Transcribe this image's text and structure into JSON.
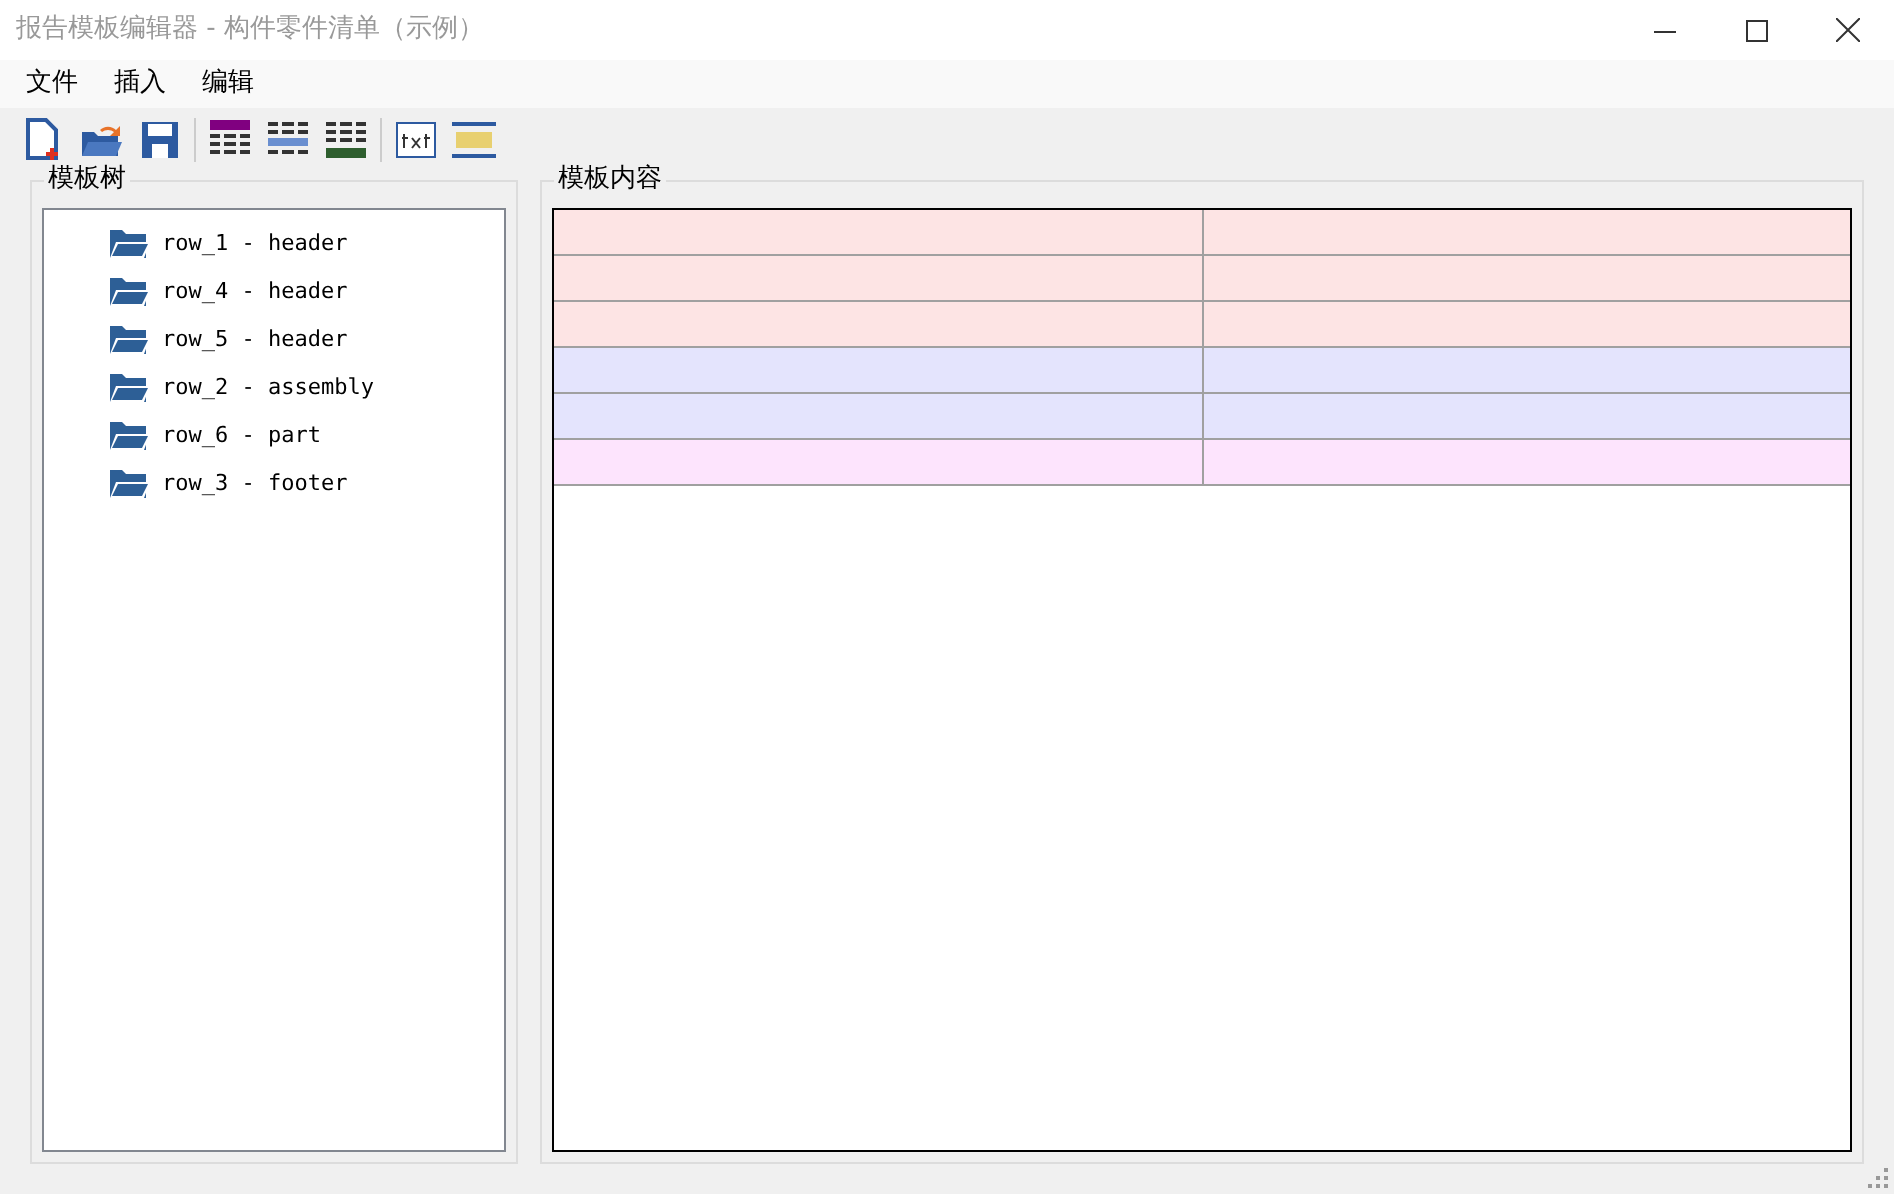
{
  "window": {
    "title": "报告模板编辑器 - 构件零件清单（示例）"
  },
  "menu": [
    "文件",
    "插入",
    "编辑"
  ],
  "toolbar": [
    {
      "kind": "new"
    },
    {
      "kind": "open"
    },
    {
      "kind": "save"
    },
    {
      "kind": "sep"
    },
    {
      "kind": "table-header"
    },
    {
      "kind": "table-body"
    },
    {
      "kind": "table-footer"
    },
    {
      "kind": "sep"
    },
    {
      "kind": "text"
    },
    {
      "kind": "label"
    }
  ],
  "tree": {
    "title": "模板树",
    "items": [
      {
        "label": "row_1 - header"
      },
      {
        "label": "row_4 - header"
      },
      {
        "label": "row_5 - header"
      },
      {
        "label": "row_2 - assembly"
      },
      {
        "label": "row_6 - part"
      },
      {
        "label": "row_3 - footer"
      }
    ]
  },
  "content": {
    "title": "模板内容",
    "rows": [
      {
        "color": "#fde4e4"
      },
      {
        "color": "#fde4e4"
      },
      {
        "color": "#fde4e4"
      },
      {
        "color": "#e4e4fd"
      },
      {
        "color": "#e4e4fd"
      },
      {
        "color": "#fde4fd"
      }
    ]
  }
}
